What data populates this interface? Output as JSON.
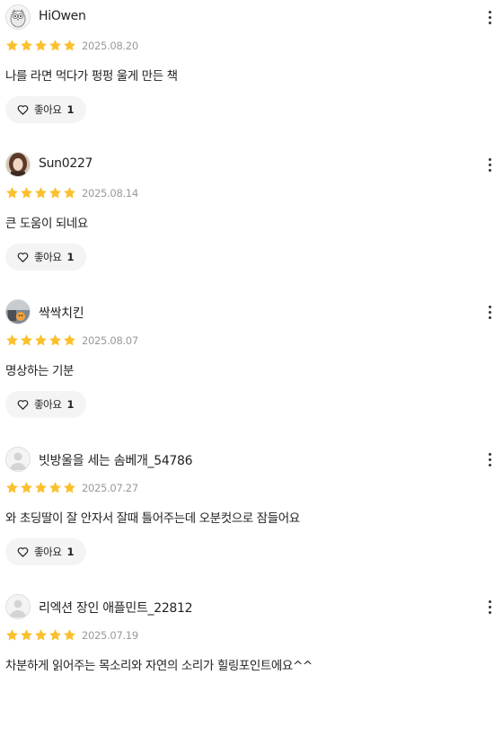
{
  "colors": {
    "star": "#FBC02D",
    "date": "#9a9a9a",
    "like_bg": "#f4f4f4"
  },
  "reviews": [
    {
      "username": "HiOwen",
      "rating": 5,
      "date": "2025.08.20",
      "text": "나를 라면 먹다가 펑펑 울게 만든 책",
      "like_label": "좋아요",
      "like_count": "1",
      "avatar_icon": "owl-avatar-icon"
    },
    {
      "username": "Sun0227",
      "rating": 5,
      "date": "2025.08.14",
      "text": "큰 도움이 되네요",
      "like_label": "좋아요",
      "like_count": "1",
      "avatar_icon": "photo-avatar-icon"
    },
    {
      "username": "싹싹치킨",
      "rating": 5,
      "date": "2025.08.07",
      "text": "명상하는 기분",
      "like_label": "좋아요",
      "like_count": "1",
      "avatar_icon": "photo-avatar-icon"
    },
    {
      "username": "빗방울을 세는 솜베개_54786",
      "rating": 5,
      "date": "2025.07.27",
      "text": "와 초딩딸이 잘 안자서 잘때 틀어주는데 오분컷으로 잠들어요",
      "like_label": "좋아요",
      "like_count": "1",
      "avatar_icon": "default-user-icon"
    },
    {
      "username": "리엑션 장인 애플민트_22812",
      "rating": 5,
      "date": "2025.07.19",
      "text": "차분하게 읽어주는 목소리와 자연의 소리가 힐링포인트에요^^",
      "like_label": "좋아요",
      "like_count": "1",
      "avatar_icon": "default-user-icon"
    }
  ]
}
